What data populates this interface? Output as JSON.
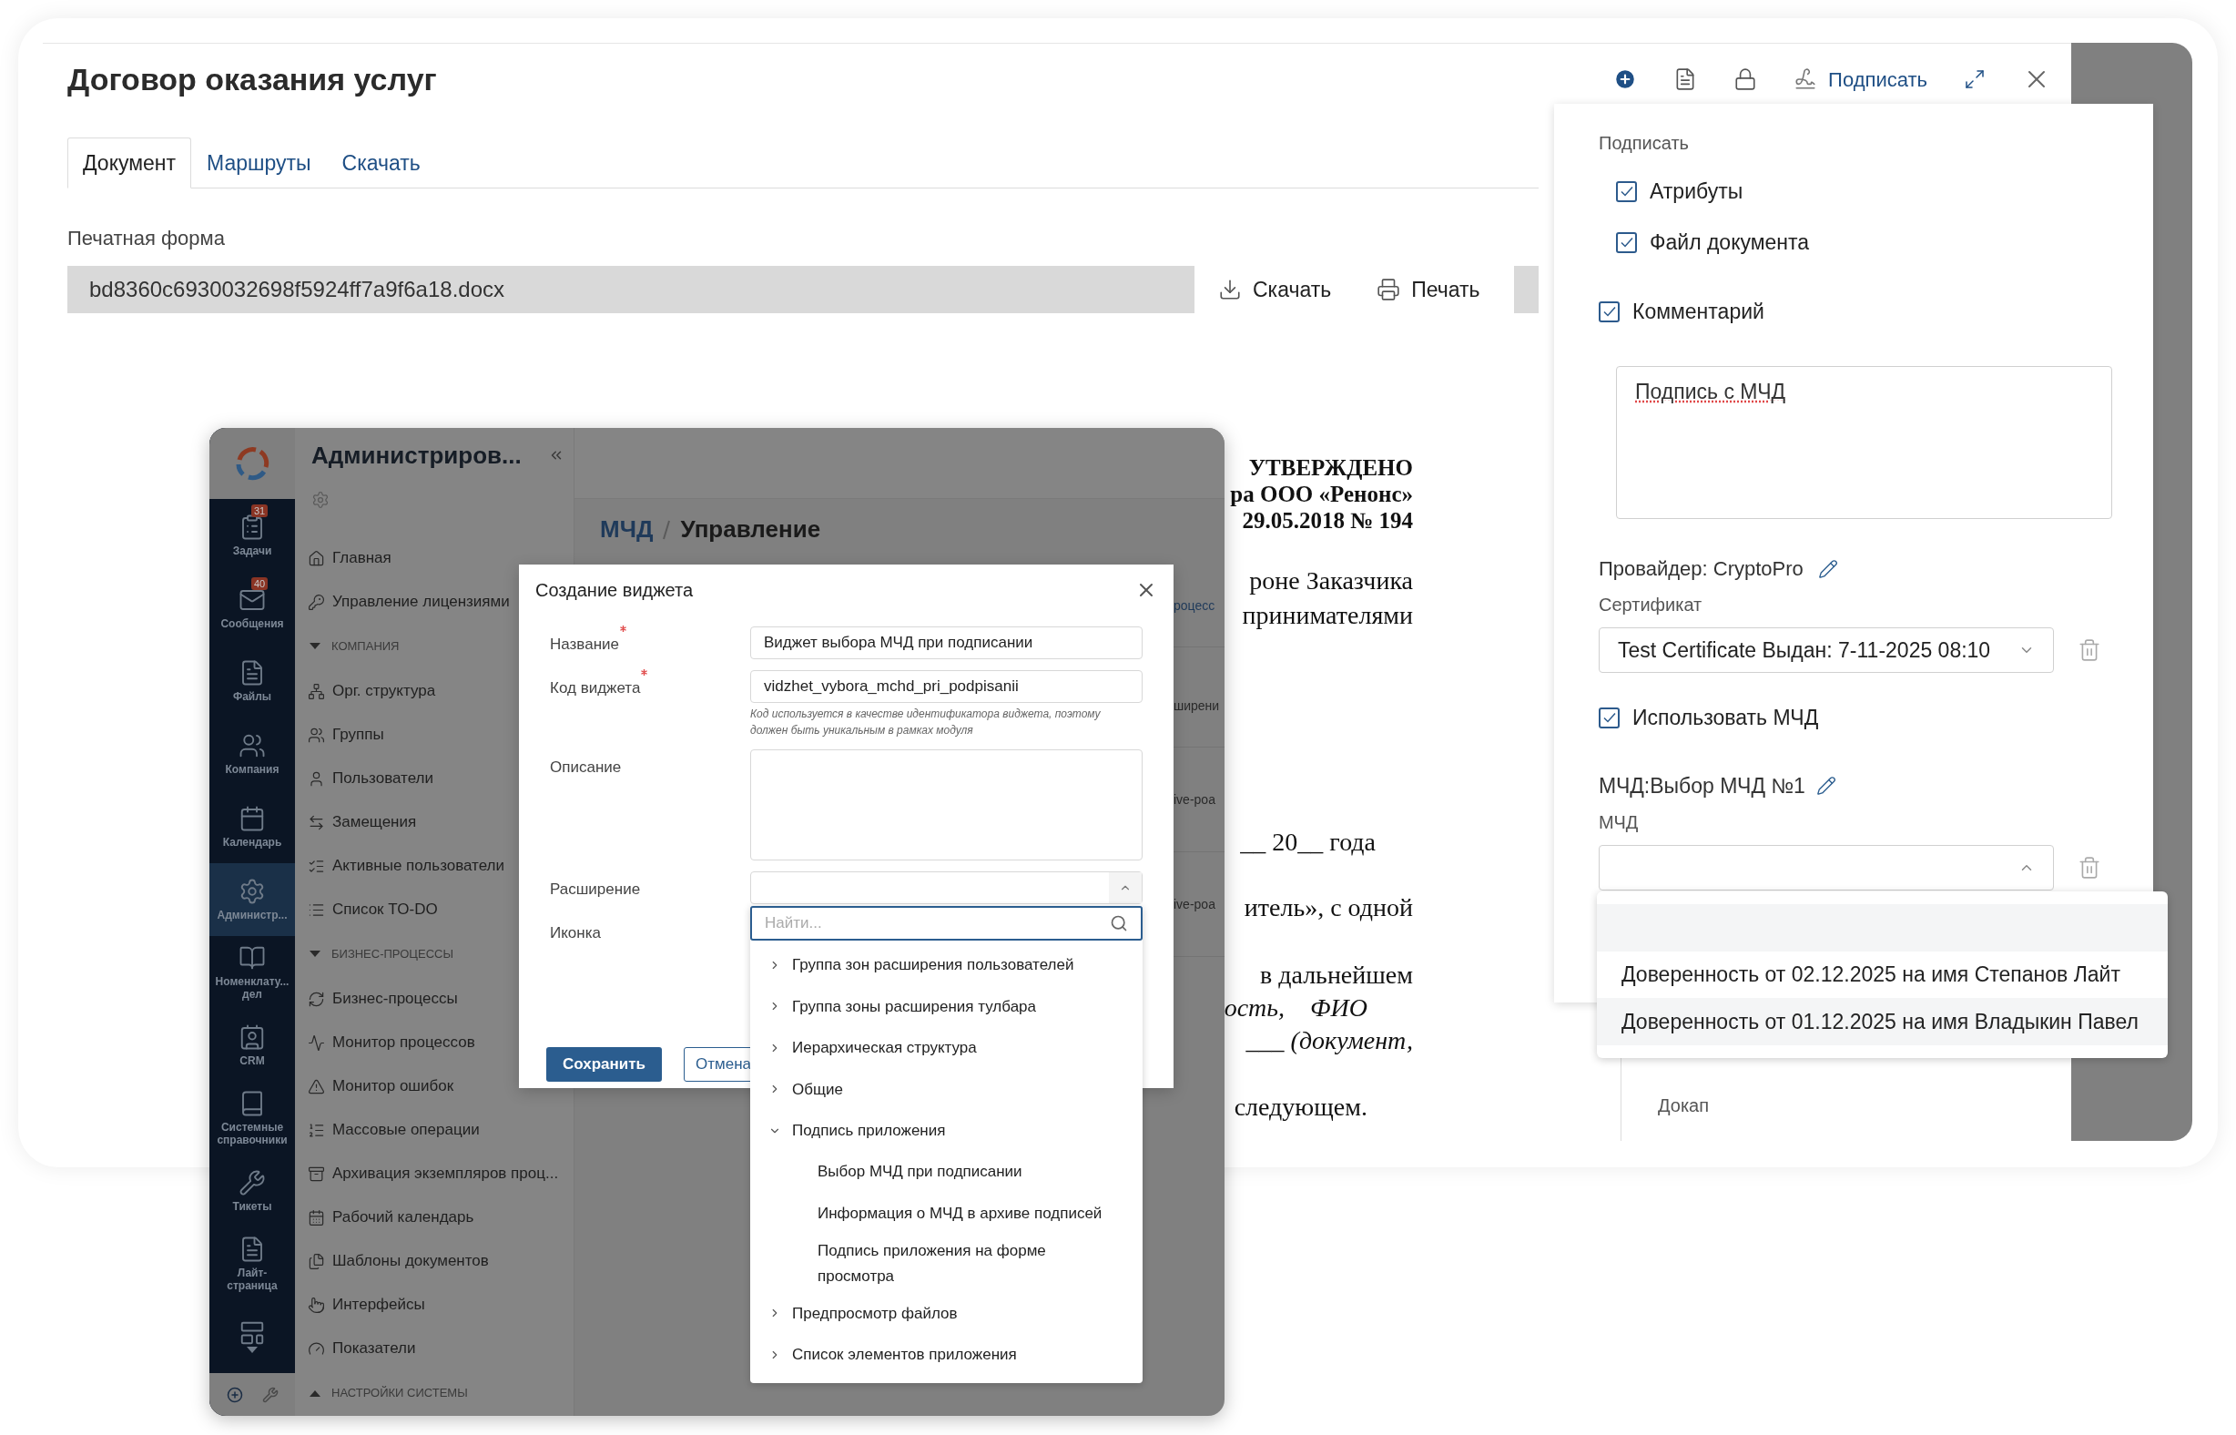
{
  "window": {
    "title": "Договор оказания услуг",
    "sign_action": "Подписать"
  },
  "tabs": [
    {
      "label": "Документ",
      "selected": true
    },
    {
      "label": "Маршруты",
      "selected": false
    },
    {
      "label": "Скачать",
      "selected": false
    }
  ],
  "print_form": {
    "label": "Печатная форма",
    "file_name": "bd8360c6930032698f5924ff7a9f6a18.docx",
    "download": "Скачать",
    "print": "Печать"
  },
  "document_fragments": [
    {
      "text": "УТВЕРЖДЕНО",
      "kind": "bold"
    },
    {
      "text": "ра ООО «Ренонс»",
      "kind": "bold"
    },
    {
      "text": "29.05.2018 № 194",
      "kind": "bold"
    },
    {
      "text": "роне Заказчика",
      "kind": "plain"
    },
    {
      "text": "принимателями",
      "kind": "plain"
    },
    {
      "text": "__ 20__ года",
      "kind": "plain"
    },
    {
      "text": "итель», с одной",
      "kind": "plain"
    },
    {
      "text": "в дальнейшем",
      "kind": "plain"
    },
    {
      "text": "ость,    ФИО",
      "kind": "italic"
    },
    {
      "text": "___ (документ,",
      "kind": "italic"
    },
    {
      "text": "следующем.",
      "kind": "plain"
    }
  ],
  "background_list": {
    "items": [
      "Докап"
    ]
  },
  "sign_panel": {
    "title": "Подписать",
    "options": [
      {
        "label": "Атрибуты",
        "checked": true,
        "kind": "sub"
      },
      {
        "label": "Файл документа",
        "checked": true,
        "kind": "sub"
      },
      {
        "label": "Комментарий",
        "checked": true,
        "kind": "main"
      }
    ],
    "comment": "Подпись с МЧД",
    "provider": "Провайдер: CryptoPro",
    "certificate_label": "Сертификат",
    "certificate_value": "Test Certificate Выдан: 7-11-2025 08:10",
    "use_mchd": {
      "label": "Использовать МЧД",
      "checked": true
    },
    "mchd_title": "МЧД:Выбор МЧД №1",
    "mchd_label": "МЧД",
    "mchd_select": {
      "expanded": true,
      "options": [
        {
          "label": "Доверенность от 02.12.2025 на имя Степанов Лайт",
          "selected": false
        },
        {
          "label": "Доверенность от 01.12.2025 на имя Владыкин Павел",
          "selected": true
        }
      ]
    }
  },
  "inner_app": {
    "nav": [
      {
        "label": "Задачи",
        "badge": "31",
        "selected": false
      },
      {
        "label": "Сообщения",
        "badge": "40",
        "selected": false
      },
      {
        "label": "Файлы",
        "selected": false
      },
      {
        "label": "Компания",
        "selected": false
      },
      {
        "label": "Календарь",
        "selected": false
      },
      {
        "label": "Администр...",
        "selected": true
      },
      {
        "label": "Номенклату...\nдел",
        "selected": false
      },
      {
        "label": "CRM",
        "selected": false
      },
      {
        "label": "Системные\nсправочники",
        "selected": false
      },
      {
        "label": "Тикеты",
        "selected": false
      },
      {
        "label": "Лайт-\nстраница",
        "selected": false
      }
    ],
    "title": "Администриров...",
    "menu": [
      {
        "kind": "item",
        "label": "Главная"
      },
      {
        "kind": "item",
        "label": "Управление лицензиями"
      },
      {
        "kind": "section",
        "label": "КОМПАНИЯ",
        "expanded": true
      },
      {
        "kind": "item",
        "label": "Орг. структура"
      },
      {
        "kind": "item",
        "label": "Группы"
      },
      {
        "kind": "item",
        "label": "Пользователи"
      },
      {
        "kind": "item",
        "label": "Замещения"
      },
      {
        "kind": "item",
        "label": "Активные пользователи"
      },
      {
        "kind": "item",
        "label": "Список TO-DO"
      },
      {
        "kind": "section",
        "label": "БИЗНЕС-ПРОЦЕССЫ",
        "expanded": true
      },
      {
        "kind": "item",
        "label": "Бизнес-процессы"
      },
      {
        "kind": "item",
        "label": "Монитор процессов"
      },
      {
        "kind": "item",
        "label": "Монитор ошибок"
      },
      {
        "kind": "item",
        "label": "Массовые операции"
      },
      {
        "kind": "item",
        "label": "Архивация экземпляров проц..."
      },
      {
        "kind": "item",
        "label": "Рабочий календарь"
      },
      {
        "kind": "item",
        "label": "Шаблоны документов"
      },
      {
        "kind": "item",
        "label": "Интерфейсы"
      },
      {
        "kind": "item",
        "label": "Показатели"
      },
      {
        "kind": "section",
        "label": "НАСТРОЙКИ СИСТЕМЫ",
        "expanded": false
      }
    ],
    "breadcrumb": [
      "МЧД",
      "Управление"
    ],
    "table_fragments": [
      "роцесс",
      "ширени",
      "ive-poa",
      "ive-poa"
    ]
  },
  "dialog": {
    "title": "Создание виджета",
    "fields": [
      {
        "label": "Название",
        "required": true,
        "kind": "text",
        "value": "Виджет выбора МЧД при подписании"
      },
      {
        "label": "Код виджета",
        "required": true,
        "kind": "text",
        "value": "vidzhet_vybora_mchd_pri_podpisanii",
        "hint": "Код используется в качестве идентификатора виджета, поэтому должен быть уникальным в рамках модуля"
      },
      {
        "label": "Описание",
        "required": false,
        "kind": "textarea"
      },
      {
        "label": "Расширение",
        "required": false,
        "kind": "select",
        "expanded": true
      },
      {
        "label": "Иконка",
        "required": false,
        "kind": "none"
      }
    ],
    "save": "Сохранить",
    "cancel": "Отмена",
    "dropdown": {
      "placeholder": "Найти...",
      "tree": [
        {
          "label": "Группа зон расширения пользователей",
          "expanded": false
        },
        {
          "label": "Группа зоны расширения тулбара",
          "expanded": false
        },
        {
          "label": "Иерархическая структура",
          "expanded": false
        },
        {
          "label": "Общие",
          "expanded": false
        },
        {
          "label": "Подпись приложения",
          "expanded": true,
          "children": [
            {
              "label": "Выбор МЧД при подписании"
            },
            {
              "label": "Информация о МЧД в архиве подписей"
            },
            {
              "label": "Подпись приложения на форме просмотра"
            }
          ]
        },
        {
          "label": "Предпросмотр файлов",
          "expanded": false
        },
        {
          "label": "Список элементов приложения",
          "expanded": false
        }
      ]
    }
  }
}
